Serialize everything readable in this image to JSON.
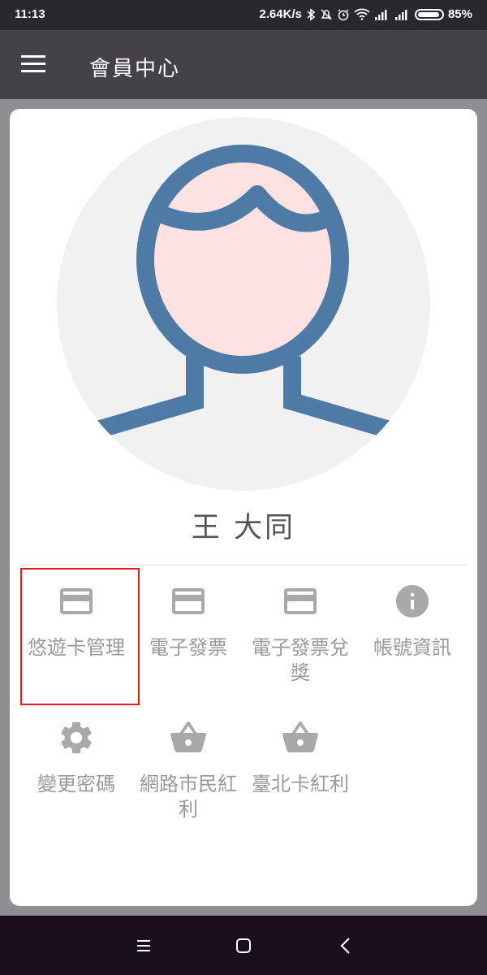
{
  "status_bar": {
    "time": "11:13",
    "network_speed": "2.64K/s",
    "battery_percent": "85%",
    "icons": [
      "bluetooth-icon",
      "mute-icon",
      "alarm-icon",
      "wifi-icon",
      "signal-icon",
      "signal-icon",
      "battery-icon"
    ]
  },
  "app_bar": {
    "title": "會員中心",
    "menu_icon": "hamburger-menu-icon"
  },
  "profile": {
    "name": "王 大同",
    "avatar_icon": "user-avatar-icon"
  },
  "menu": {
    "items": [
      {
        "label": "悠遊卡管理",
        "icon": "credit-card-icon",
        "selected": true
      },
      {
        "label": "電子發票",
        "icon": "credit-card-icon"
      },
      {
        "label": "電子發票兌獎",
        "icon": "credit-card-icon"
      },
      {
        "label": "帳號資訊",
        "icon": "info-icon"
      },
      {
        "label": "變更密碼",
        "icon": "gear-icon"
      },
      {
        "label": "網路市民紅利",
        "icon": "shopping-basket-icon"
      },
      {
        "label": "臺北卡紅利",
        "icon": "shopping-basket-icon"
      }
    ]
  },
  "nav_bar": {
    "buttons": [
      "menu-icon",
      "home-icon",
      "back-icon"
    ]
  },
  "colors": {
    "app_bar": "#454148",
    "status_bar": "#2a272d",
    "background": "#8f8e92",
    "icon_gray": "#a7a9ab",
    "avatar_stroke": "#4e7aa6",
    "avatar_face": "#fde2e1",
    "selection_border": "#e81a1a"
  }
}
